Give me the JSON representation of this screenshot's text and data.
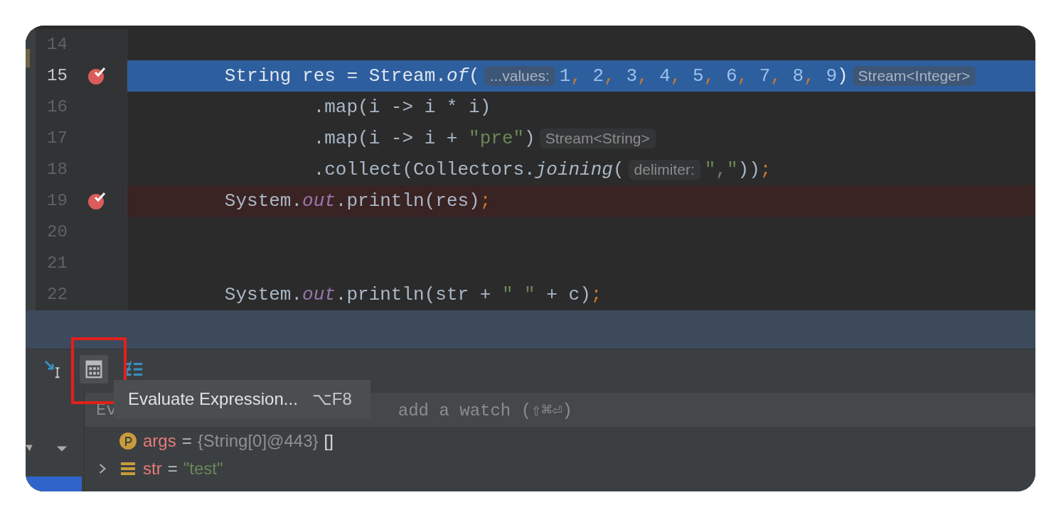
{
  "editor": {
    "lines": [
      {
        "number": "14",
        "breakpoint": false,
        "execution_point": false
      },
      {
        "number": "15",
        "breakpoint": true,
        "execution_point": true,
        "tokens": [
          {
            "text": "        String res = Stream.",
            "kind": "plain"
          },
          {
            "text": "of",
            "kind": "italic"
          },
          {
            "text": "(",
            "kind": "plain"
          },
          {
            "text": "...values:",
            "kind": "hint"
          },
          {
            "text": "1",
            "kind": "number"
          },
          {
            "text": ", ",
            "kind": "punct"
          },
          {
            "text": "2",
            "kind": "number"
          },
          {
            "text": ", ",
            "kind": "punct"
          },
          {
            "text": "3",
            "kind": "number"
          },
          {
            "text": ", ",
            "kind": "punct"
          },
          {
            "text": "4",
            "kind": "number"
          },
          {
            "text": ", ",
            "kind": "punct"
          },
          {
            "text": "5",
            "kind": "number"
          },
          {
            "text": ", ",
            "kind": "punct"
          },
          {
            "text": "6",
            "kind": "number"
          },
          {
            "text": ", ",
            "kind": "punct"
          },
          {
            "text": "7",
            "kind": "number"
          },
          {
            "text": ", ",
            "kind": "punct"
          },
          {
            "text": "8",
            "kind": "number"
          },
          {
            "text": ", ",
            "kind": "punct"
          },
          {
            "text": "9",
            "kind": "number"
          },
          {
            "text": ")",
            "kind": "plain"
          },
          {
            "text": "Stream<Integer>",
            "kind": "hint"
          }
        ]
      },
      {
        "number": "16",
        "breakpoint": false,
        "execution_point": false,
        "tokens": [
          {
            "text": "                .map(i -> i * i)",
            "kind": "plain"
          }
        ]
      },
      {
        "number": "17",
        "breakpoint": false,
        "execution_point": false,
        "tokens": [
          {
            "text": "                .map(i -> i + ",
            "kind": "plain"
          },
          {
            "text": "\"pre\"",
            "kind": "string"
          },
          {
            "text": ")",
            "kind": "plain"
          },
          {
            "text": "Stream<String>",
            "kind": "hint"
          }
        ]
      },
      {
        "number": "18",
        "breakpoint": false,
        "execution_point": false,
        "tokens": [
          {
            "text": "                .collect(Collectors.",
            "kind": "plain"
          },
          {
            "text": "joining",
            "kind": "italic"
          },
          {
            "text": "(",
            "kind": "plain"
          },
          {
            "text": "delimiter:",
            "kind": "hint"
          },
          {
            "text": "\",\"",
            "kind": "string"
          },
          {
            "text": "))",
            "kind": "plain"
          },
          {
            "text": ";",
            "kind": "punct"
          }
        ]
      },
      {
        "number": "19",
        "breakpoint": true,
        "execution_point": false,
        "tokens": [
          {
            "text": "        System.",
            "kind": "plain"
          },
          {
            "text": "out",
            "kind": "field"
          },
          {
            "text": ".println(res)",
            "kind": "plain"
          },
          {
            "text": ";",
            "kind": "punct"
          }
        ]
      },
      {
        "number": "20",
        "breakpoint": false,
        "execution_point": false
      },
      {
        "number": "21",
        "breakpoint": false,
        "execution_point": false
      },
      {
        "number": "22",
        "breakpoint": false,
        "execution_point": false,
        "tokens": [
          {
            "text": "        System.",
            "kind": "plain"
          },
          {
            "text": "out",
            "kind": "field"
          },
          {
            "text": ".println(str + ",
            "kind": "plain"
          },
          {
            "text": "\" \"",
            "kind": "string"
          },
          {
            "text": " + c)",
            "kind": "plain"
          },
          {
            "text": ";",
            "kind": "punct"
          }
        ]
      }
    ]
  },
  "debug_toolbar": {
    "buttons": [
      {
        "kind": "step",
        "hovered": false
      },
      {
        "kind": "calculator",
        "hovered": true
      },
      {
        "kind": "list",
        "hovered": false
      }
    ]
  },
  "tooltip": {
    "label": "Evaluate Expression...",
    "shortcut": "⌥F8"
  },
  "watch_field": {
    "placeholder_start": "Ev",
    "placeholder_end": "add a watch (⇧⌘⏎)"
  },
  "variables": [
    {
      "kind": "param",
      "expandable": false,
      "name": "args",
      "separator": "=",
      "value": [
        {
          "text": "{String[0]@443}",
          "kind": "ref"
        },
        {
          "text": "[]",
          "kind": "plain"
        }
      ]
    },
    {
      "kind": "field",
      "expandable": true,
      "name": "str",
      "separator": "=",
      "value": [
        {
          "text": "\"test\"",
          "kind": "string"
        }
      ]
    }
  ]
}
